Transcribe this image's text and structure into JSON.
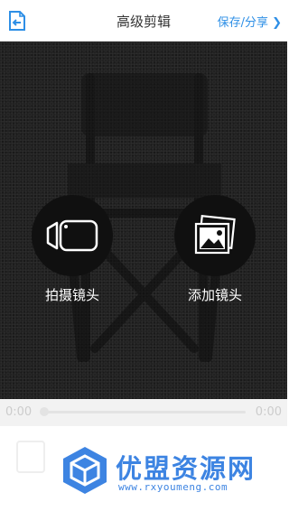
{
  "header": {
    "title": "高级剪辑",
    "share_label": "保存/分享",
    "share_chevron": "❯",
    "back_icon": "back-arrow-icon"
  },
  "stage": {
    "background_icon": "director-chair-icon",
    "actions": [
      {
        "label": "拍摄镜头",
        "icon": "video-camera-icon"
      },
      {
        "label": "添加镜头",
        "icon": "photo-album-icon"
      }
    ]
  },
  "timeline": {
    "start_time": "0:00",
    "end_time": "0:00",
    "progress": 0
  },
  "watermark": {
    "name": "优盟资源网",
    "url": "www.rxyoumeng.com",
    "icon": "cube-logo-icon"
  },
  "colors": {
    "accent": "#2e8fe6",
    "stage_bg": "#222222",
    "watermark": "#3d84e2"
  }
}
